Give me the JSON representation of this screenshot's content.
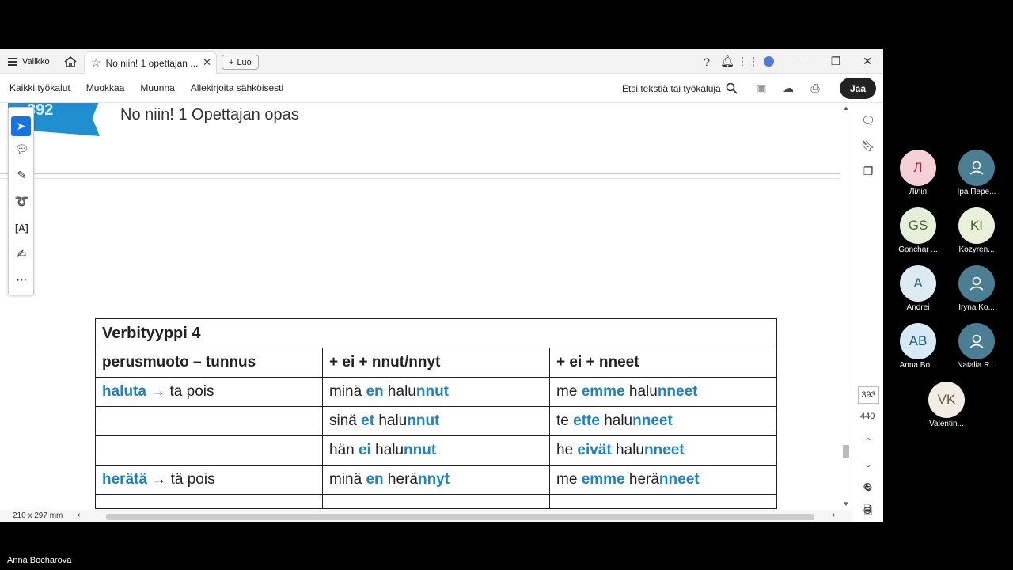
{
  "window": {
    "menu_label": "Valikko",
    "tab_title": "No niin! 1 opettajan ...",
    "new_button": "Luo",
    "close_glyph": "✕"
  },
  "toolbar": {
    "items": [
      "Kaikki työkalut",
      "Muokkaa",
      "Muunna",
      "Allekirjoita sähköisesti"
    ],
    "search_label": "Etsi tekstiä tai työkaluja",
    "share_label": "Jaa"
  },
  "document": {
    "page_badge": "392",
    "title": "No niin! 1 Opettajan opas",
    "table": {
      "title": "Verbityyppi 4",
      "headers": [
        "perusmuoto – tunnus",
        "+ ei + nnut/nnyt",
        "+ ei + nneet"
      ],
      "rows": [
        {
          "c1a": "haluta",
          "c1b": " → ta pois",
          "c2a": "minä ",
          "c2b": "en",
          "c2c": " halu",
          "c2d": "nnut",
          "c3a": "me ",
          "c3b": "emme",
          "c3c": " halu",
          "c3d": "nneet"
        },
        {
          "c1a": "",
          "c1b": "",
          "c2a": "sinä ",
          "c2b": "et",
          "c2c": " halu",
          "c2d": "nnut",
          "c3a": "te ",
          "c3b": "ette",
          "c3c": " halu",
          "c3d": "nneet"
        },
        {
          "c1a": "",
          "c1b": "",
          "c2a": "hän ",
          "c2b": "ei",
          "c2c": " halu",
          "c2d": "nnut",
          "c3a": "he ",
          "c3b": "eivät",
          "c3c": " halu",
          "c3d": "nneet"
        },
        {
          "c1a": "herätä",
          "c1b": " → tä pois",
          "c2a": "minä ",
          "c2b": "en",
          "c2c": " herä",
          "c2d": "nnyt",
          "c3a": "me ",
          "c3b": "emme",
          "c3c": " herä",
          "c3d": "nneet"
        }
      ]
    }
  },
  "viewer": {
    "page_current": "393",
    "page_total": "440",
    "page_size": "210 x 297 mm"
  },
  "participants": [
    {
      "initials": "Л",
      "name": "Лілія",
      "bg": "#f3d1d6",
      "fg": "#b3243f"
    },
    {
      "initials": "",
      "name": "Іра Пере...",
      "bg": "#4a7e92",
      "fg": "#ffffff"
    },
    {
      "initials": "GS",
      "name": "Gonchar ...",
      "bg": "#e6efd9",
      "fg": "#4a6430"
    },
    {
      "initials": "KI",
      "name": "Kozyren...",
      "bg": "#e9f1db",
      "fg": "#4a6430"
    },
    {
      "initials": "A",
      "name": "Andrei",
      "bg": "#dcebf2",
      "fg": "#2e6a86"
    },
    {
      "initials": "",
      "name": "Iryna Ko...",
      "bg": "#4a7e92",
      "fg": "#ffffff"
    },
    {
      "initials": "AB",
      "name": "Anna Bo...",
      "bg": "#d6e9f5",
      "fg": "#1c5c86"
    },
    {
      "initials": "",
      "name": "Natalia R...",
      "bg": "#4a7e92",
      "fg": "#ffffff"
    },
    {
      "initials": "VK",
      "name": "Valentin...",
      "bg": "#f1ece4",
      "fg": "#6b5a45"
    }
  ],
  "meeting": {
    "active_speaker": "Anna Bocharova"
  }
}
